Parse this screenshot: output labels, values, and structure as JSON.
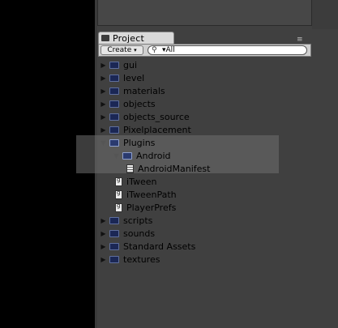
{
  "panel": {
    "tab_label": "Project",
    "menu_glyph": "≡"
  },
  "toolbar": {
    "create_label": "Create",
    "create_arrow": "▾",
    "search_icon": "search-icon",
    "search_value": "▾All"
  },
  "tree": [
    {
      "label": "gui",
      "kind": "folder",
      "expanded": false
    },
    {
      "label": "level",
      "kind": "folder",
      "expanded": false
    },
    {
      "label": "materials",
      "kind": "folder",
      "expanded": false
    },
    {
      "label": "objects",
      "kind": "folder",
      "expanded": false
    },
    {
      "label": "objects_source",
      "kind": "folder",
      "expanded": false
    },
    {
      "label": "Pixelplacement",
      "kind": "folder",
      "expanded": false
    },
    {
      "label": "Plugins",
      "kind": "folder",
      "expanded": true
    },
    {
      "label": "Android",
      "kind": "folder",
      "expanded": true
    },
    {
      "label": "AndroidManifest",
      "kind": "file"
    },
    {
      "label": "iTween",
      "kind": "script"
    },
    {
      "label": "iTweenPath",
      "kind": "script"
    },
    {
      "label": "PlayerPrefs",
      "kind": "script"
    },
    {
      "label": "scripts",
      "kind": "folder",
      "expanded": false
    },
    {
      "label": "sounds",
      "kind": "folder",
      "expanded": false
    },
    {
      "label": "Standard Assets",
      "kind": "folder",
      "expanded": false
    },
    {
      "label": "textures",
      "kind": "folder",
      "expanded": false
    }
  ],
  "glyphs": {
    "collapsed": "▶",
    "expanded": "▼"
  }
}
